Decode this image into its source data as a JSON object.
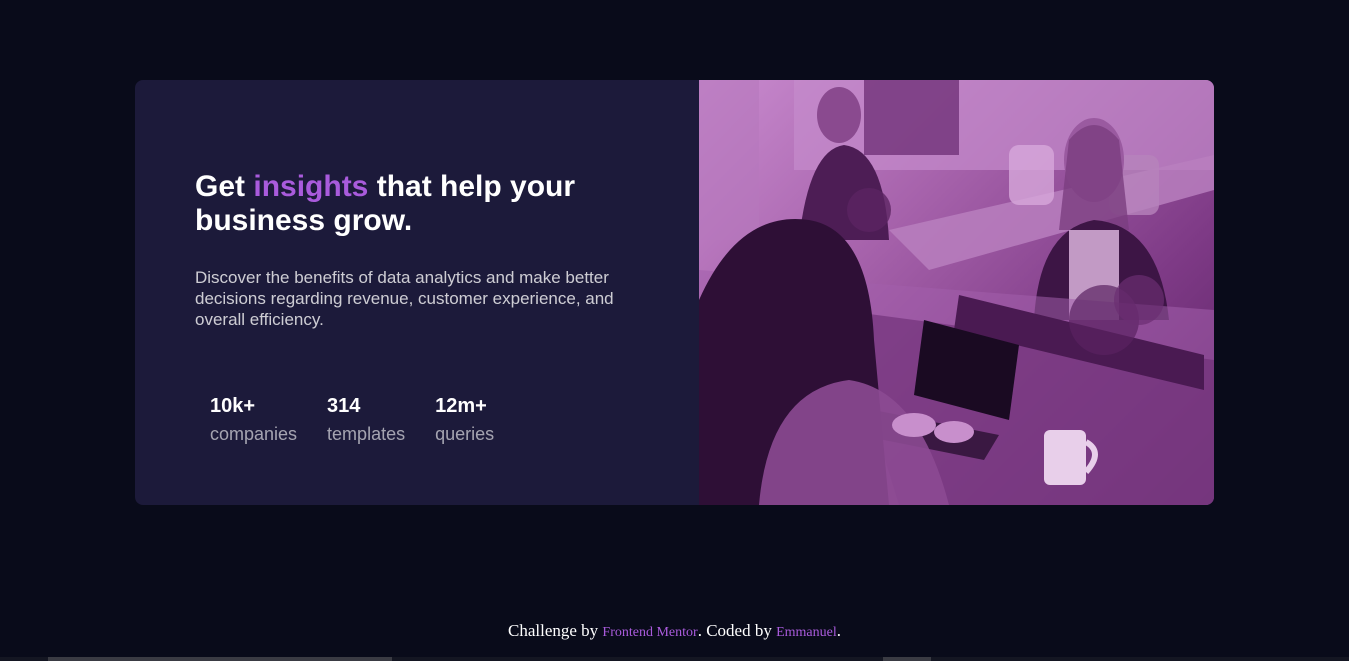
{
  "hero": {
    "title_before": "Get ",
    "title_accent": "insights",
    "title_after": " that help your business grow.",
    "description": "Discover the benefits of data analytics and make better decisions regarding revenue, customer experience, and overall efficiency."
  },
  "stats": [
    {
      "value": "10k+",
      "label": "companies"
    },
    {
      "value": "314",
      "label": "templates"
    },
    {
      "value": "12m+",
      "label": "queries"
    }
  ],
  "footer": {
    "prefix": "Challenge by ",
    "link1": "Frontend Mentor",
    "middle": ". Coded by ",
    "link2": "Emmanuel",
    "suffix": "."
  },
  "colors": {
    "background": "#090b1a",
    "card": "#1c1a3a",
    "accent": "#a95bdc",
    "image_overlay": "#aa5cdb"
  }
}
